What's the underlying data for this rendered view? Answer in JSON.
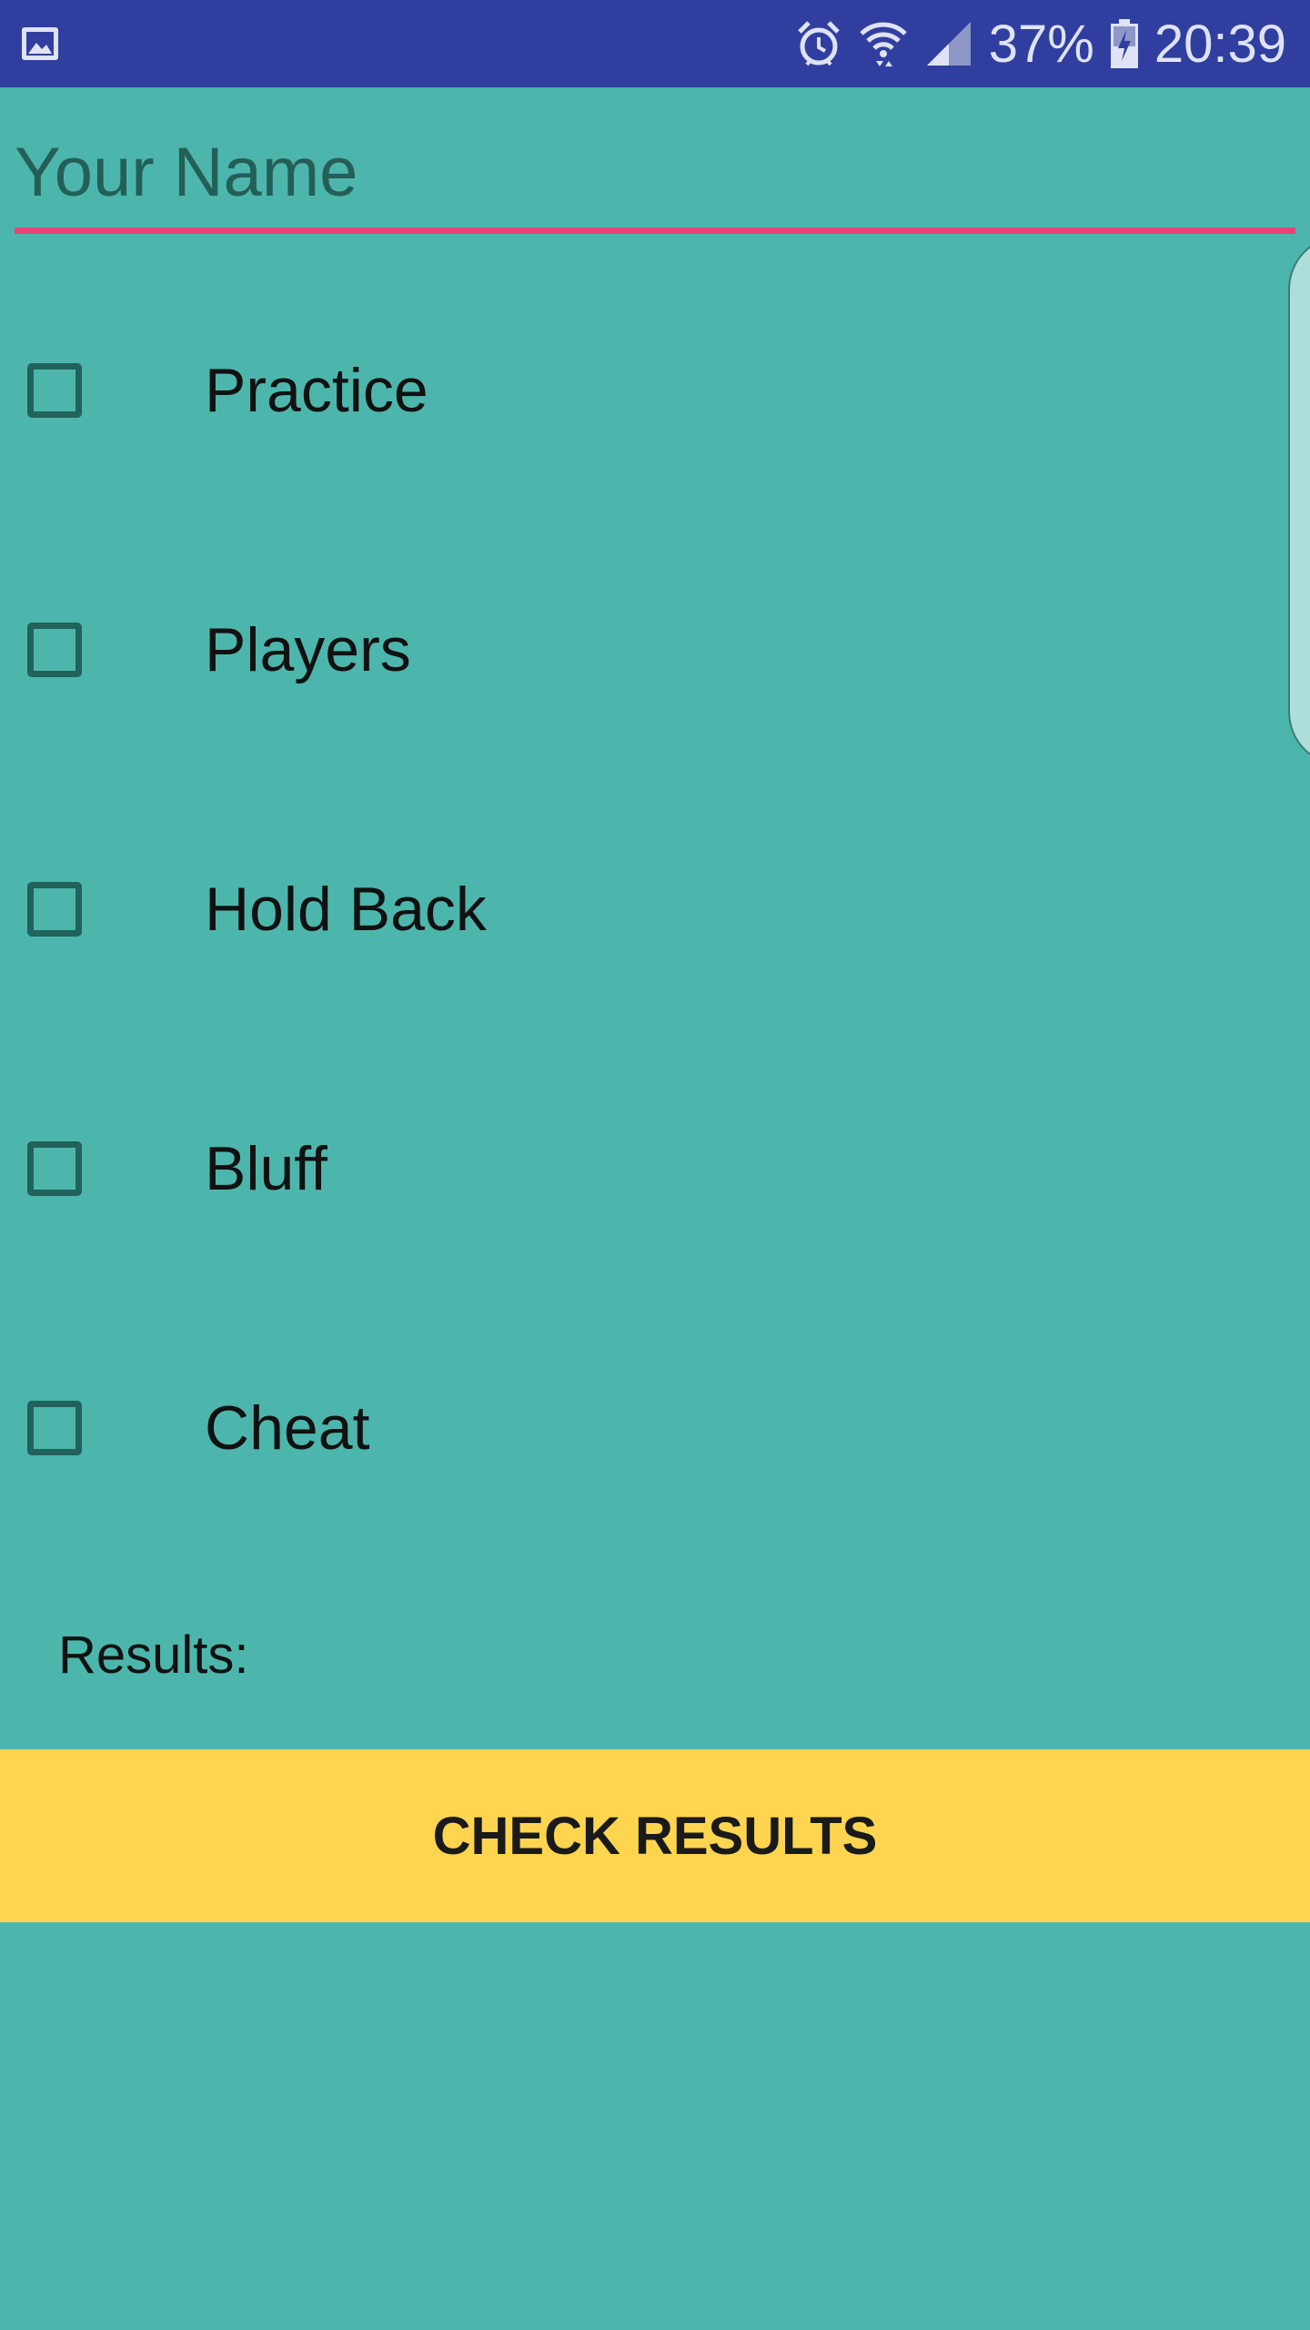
{
  "status_bar": {
    "battery_percent": "37%",
    "time": "20:39",
    "icons": [
      "gallery-icon",
      "alarm-icon",
      "wifi-icon",
      "signal-icon",
      "battery-charging-icon"
    ]
  },
  "form": {
    "name_placeholder": "Your Name",
    "name_value": ""
  },
  "options": [
    {
      "label": "Practice",
      "checked": false
    },
    {
      "label": "Players",
      "checked": false
    },
    {
      "label": "Hold Back",
      "checked": false
    },
    {
      "label": "Bluff",
      "checked": false
    },
    {
      "label": "Cheat",
      "checked": false
    }
  ],
  "results": {
    "label": "Results:"
  },
  "button": {
    "label": "CHECK RESULTS"
  },
  "colors": {
    "background": "#4db6ac",
    "status_bar": "#303f9f",
    "accent": "#ec407a",
    "button": "#ffd54f"
  }
}
